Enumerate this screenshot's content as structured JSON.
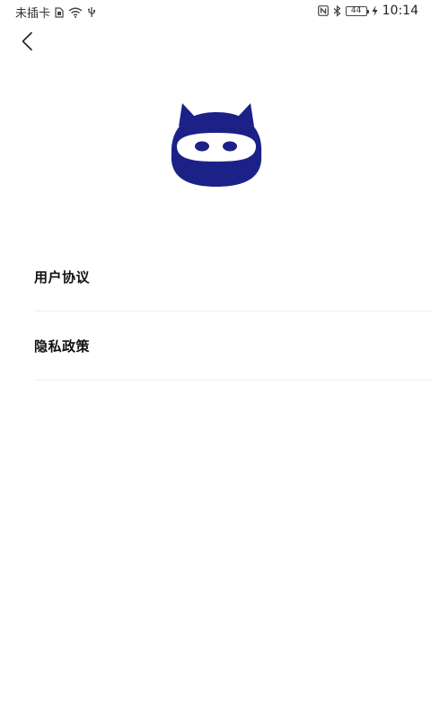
{
  "status_bar": {
    "carrier": "未插卡",
    "battery_level": "44",
    "time": "10:14"
  },
  "menu": {
    "items": [
      {
        "label": "用户协议"
      },
      {
        "label": "隐私政策"
      }
    ]
  },
  "colors": {
    "logo_primary": "#1b2187",
    "divider": "#eeeeee"
  },
  "icons": {
    "back": "chevron-left-icon",
    "logo": "ninja-mascot-logo"
  }
}
